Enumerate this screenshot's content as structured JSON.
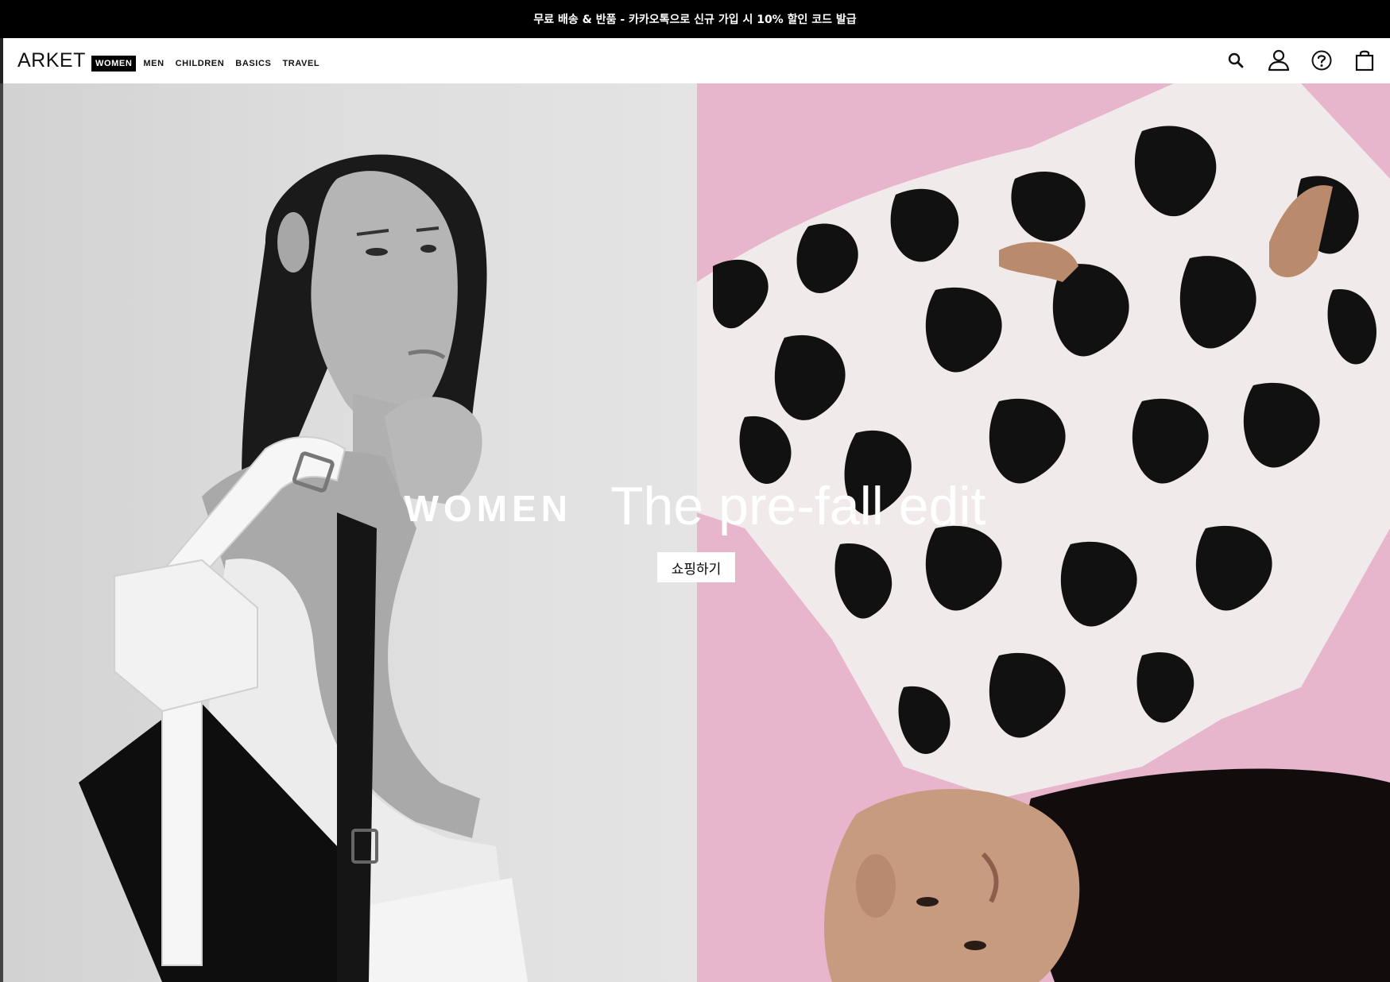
{
  "promo_bar": {
    "text": "무료 배송 & 반품 - 카카오톡으로 신규 가입 시 10% 할인 코드 발급"
  },
  "header": {
    "logo": "ARKET",
    "nav": [
      {
        "label": "WOMEN",
        "active": true
      },
      {
        "label": "MEN",
        "active": false
      },
      {
        "label": "CHILDREN",
        "active": false
      },
      {
        "label": "BASICS",
        "active": false
      },
      {
        "label": "TRAVEL",
        "active": false
      }
    ],
    "icons": [
      "search-icon",
      "account-icon",
      "help-icon",
      "bag-icon"
    ]
  },
  "hero": {
    "category": "WOMEN",
    "title": "The pre-fall edit",
    "cta_label": "쇼핑하기",
    "left_image": "model-with-white-bag",
    "right_image": "model-in-zebra-print",
    "colors": {
      "right_background": "#e7b6cd",
      "left_background": "#dcdcdc",
      "text": "#ffffff"
    }
  }
}
